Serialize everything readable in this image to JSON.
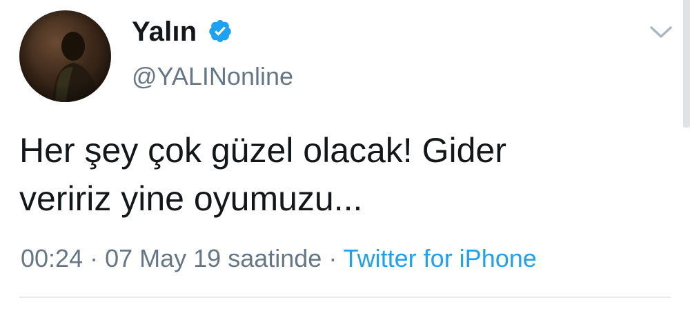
{
  "user": {
    "display_name": "Yalın",
    "handle": "@YALINonline",
    "verified": true
  },
  "tweet": {
    "line1": "Her şey çok güzel olacak! Gider",
    "line2": "veririz yine oyumuzu..."
  },
  "meta": {
    "time": "00:24",
    "date": "07 May 19 saatinde",
    "separator": " · ",
    "source": "Twitter for iPhone"
  },
  "icons": {
    "verified": "verified-badge-icon",
    "menu": "chevron-down-icon"
  },
  "colors": {
    "text": "#14171a",
    "secondary": "#657786",
    "accent": "#1da1f2",
    "divider": "#e6ecf0"
  }
}
